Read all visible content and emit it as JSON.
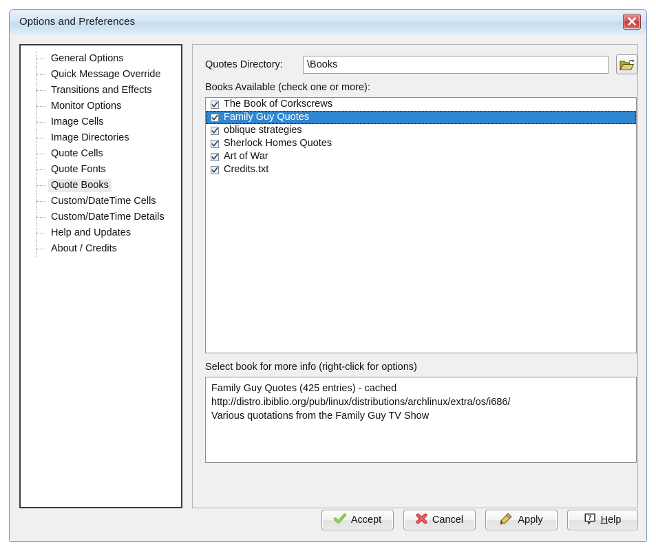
{
  "window": {
    "title": "Options and Preferences",
    "close_icon": "close-x-icon"
  },
  "sidebar": {
    "items": [
      {
        "label": "General Options",
        "selected": false
      },
      {
        "label": "Quick Message Override",
        "selected": false
      },
      {
        "label": "Transitions and Effects",
        "selected": false
      },
      {
        "label": "Monitor Options",
        "selected": false
      },
      {
        "label": "Image Cells",
        "selected": false
      },
      {
        "label": "Image Directories",
        "selected": false
      },
      {
        "label": "Quote Cells",
        "selected": false
      },
      {
        "label": "Quote Fonts",
        "selected": false
      },
      {
        "label": "Quote Books",
        "selected": true
      },
      {
        "label": "Custom/DateTime Cells",
        "selected": false
      },
      {
        "label": "Custom/DateTime Details",
        "selected": false
      },
      {
        "label": "Help and Updates",
        "selected": false
      },
      {
        "label": "About / Credits",
        "selected": false
      }
    ]
  },
  "main": {
    "directory": {
      "label": "Quotes Directory:",
      "value": "\\Books",
      "browse_icon": "open-folder-icon"
    },
    "books_label": "Books Available (check one or more):",
    "books": [
      {
        "name": "The Book of Corkscrews",
        "checked": true,
        "selected": false
      },
      {
        "name": "Family Guy Quotes",
        "checked": true,
        "selected": true
      },
      {
        "name": "oblique strategies",
        "checked": true,
        "selected": false
      },
      {
        "name": "Sherlock Homes Quotes",
        "checked": true,
        "selected": false
      },
      {
        "name": "Art of War",
        "checked": true,
        "selected": false
      },
      {
        "name": "Credits.txt",
        "checked": true,
        "selected": false
      }
    ],
    "info_label": "Select book for more info (right-click for options)",
    "info_lines": [
      "Family Guy Quotes (425 entries) - cached",
      "http://distro.ibiblio.org/pub/linux/distributions/archlinux/extra/os/i686/",
      "Various quotations from the Family Guy TV Show"
    ]
  },
  "footer": {
    "accept": "Accept",
    "cancel": "Cancel",
    "apply": "Apply",
    "help": "Help"
  },
  "colors": {
    "selection_blue": "#2f86d2",
    "title_blue": "#c5dcf0",
    "close_red": "#bf3d3d",
    "accept_green": "#7fbf2f",
    "cancel_red": "#e04545",
    "apply_gold": "#e0b428"
  }
}
